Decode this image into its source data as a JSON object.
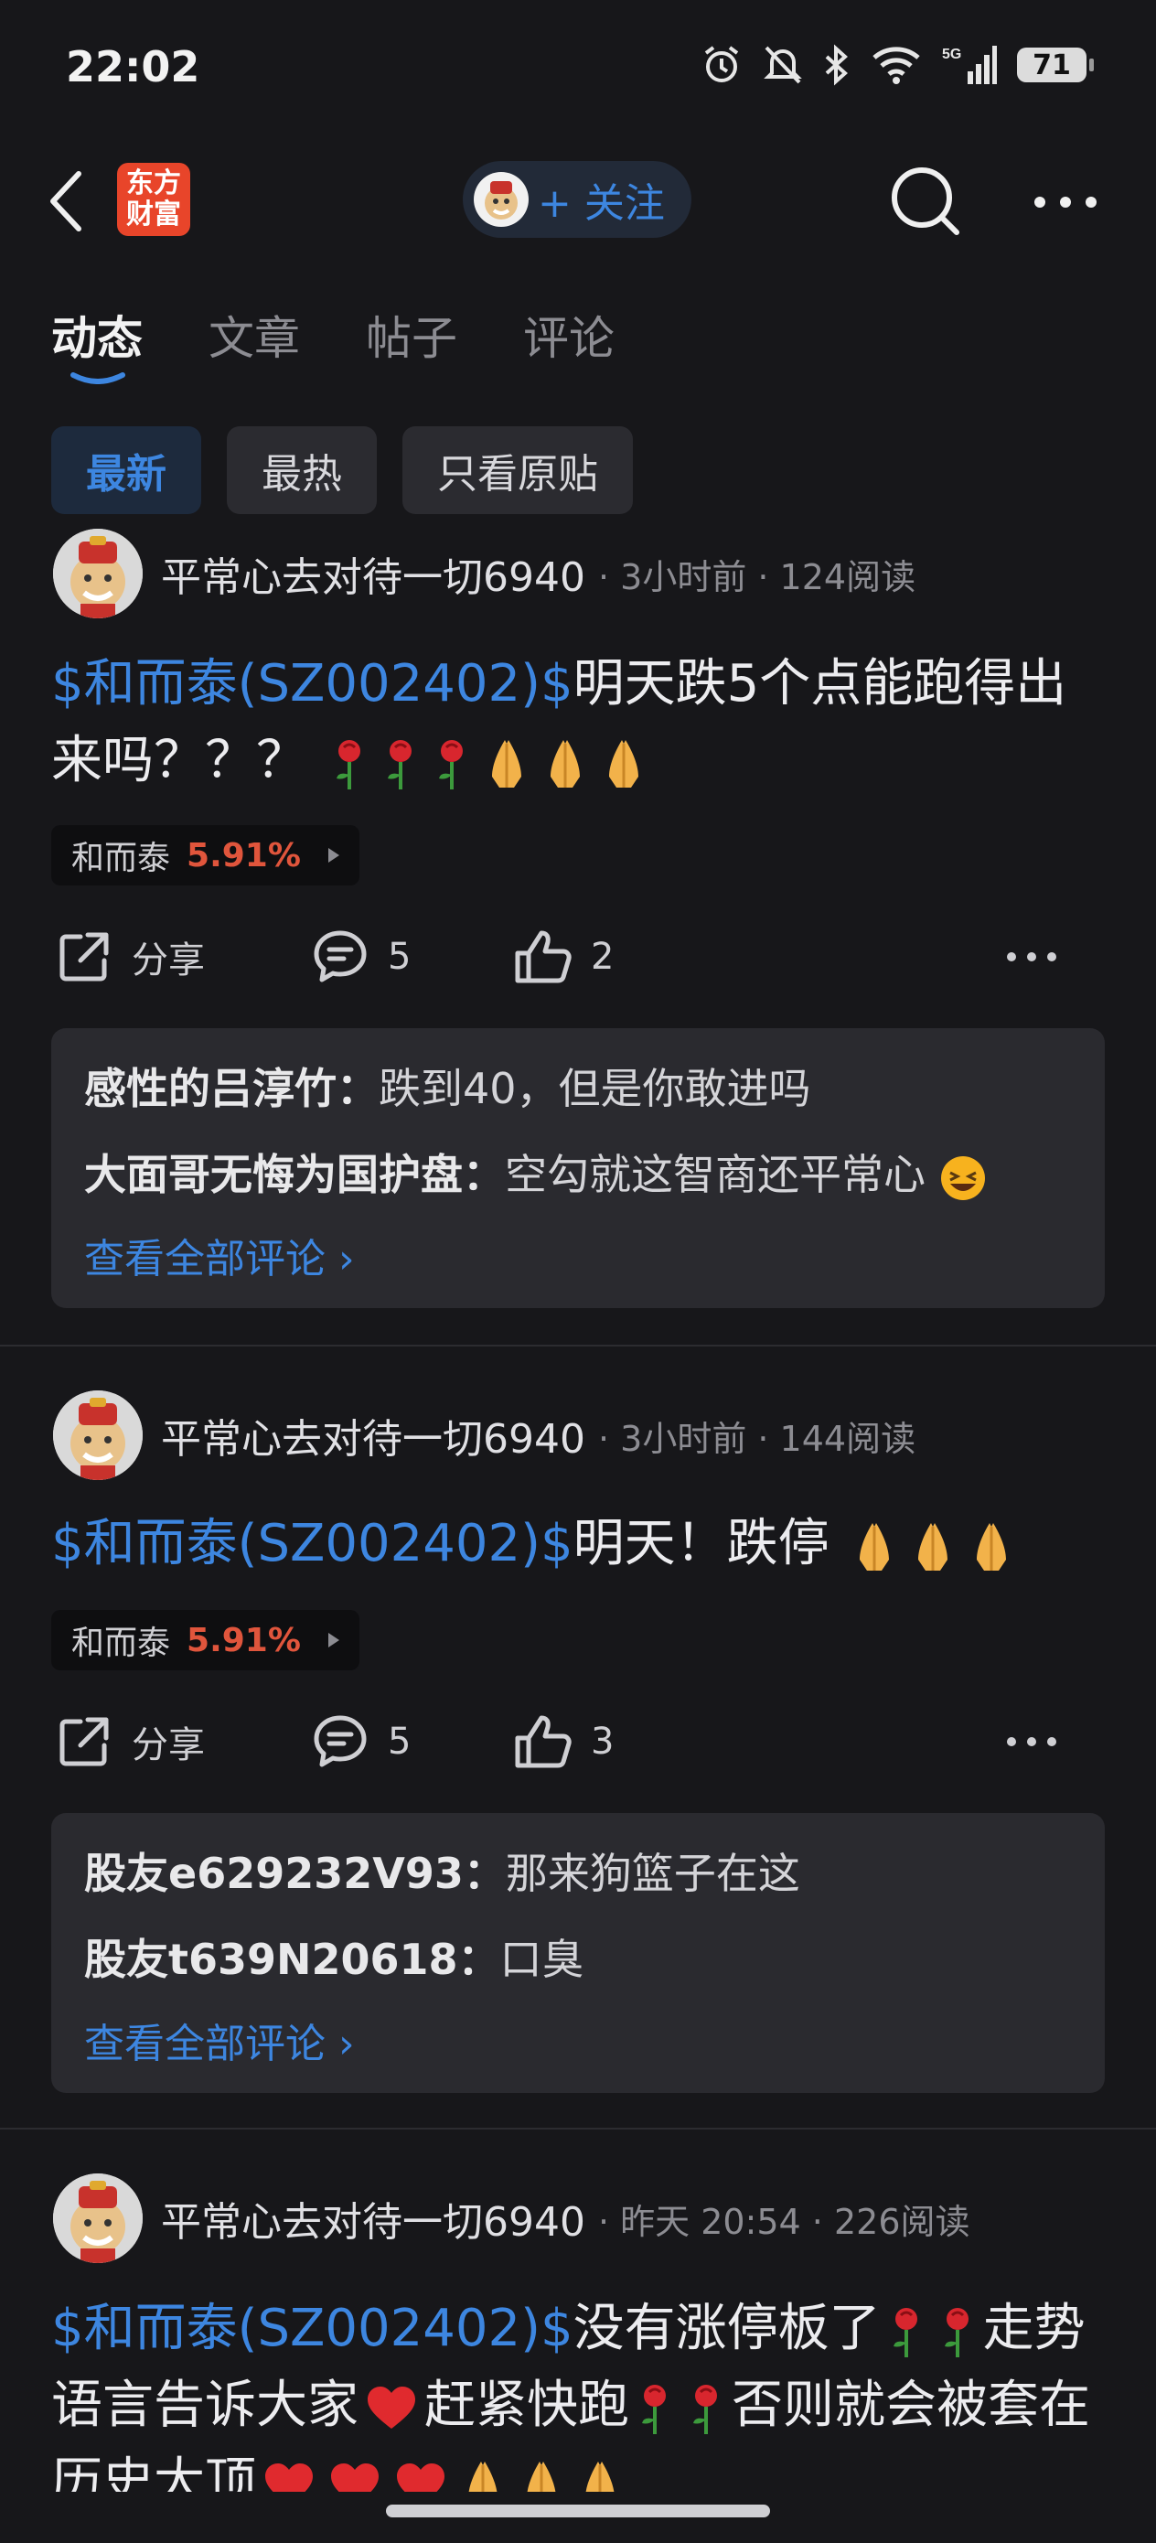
{
  "status": {
    "time": "22:02",
    "battery": "71",
    "network": "5G"
  },
  "header": {
    "logo_line1": "东方",
    "logo_line2": "财富",
    "follow_label": "+ 关注"
  },
  "tabs": [
    {
      "label": "动态",
      "active": true
    },
    {
      "label": "文章",
      "active": false
    },
    {
      "label": "帖子",
      "active": false
    },
    {
      "label": "评论",
      "active": false
    }
  ],
  "filters": [
    {
      "label": "最新",
      "active": true
    },
    {
      "label": "最热",
      "active": false
    },
    {
      "label": "只看原贴",
      "active": false
    }
  ],
  "posts": [
    {
      "user": "平常心去对待一切6940",
      "meta": "· 3小时前 · 124阅读",
      "tag": "$和而泰(SZ002402)$",
      "text": "明天跌5个点能跑得出来吗？？？",
      "quote_name": "和而泰",
      "quote_pct": "5.91%",
      "share_label": "分享",
      "comment_count": "5",
      "like_count": "2",
      "comments": [
        {
          "user": "感性的吕淳竹：",
          "text": "跌到40，但是你敢进吗"
        },
        {
          "user": "大面哥无悔为国护盘：",
          "text": "空勾就这智商还平常心"
        }
      ],
      "view_all": "查看全部评论"
    },
    {
      "user": "平常心去对待一切6940",
      "meta": "· 3小时前 · 144阅读",
      "tag": "$和而泰(SZ002402)$",
      "text": "明天！跌停",
      "quote_name": "和而泰",
      "quote_pct": "5.91%",
      "share_label": "分享",
      "comment_count": "5",
      "like_count": "3",
      "comments": [
        {
          "user": "股友e629232V93：",
          "text": "那来狗篮子在这"
        },
        {
          "user": "股友t639N20618：",
          "text": "口臭"
        }
      ],
      "view_all": "查看全部评论"
    },
    {
      "user": "平常心去对待一切6940",
      "meta": "· 昨天 20:54 · 226阅读",
      "tag": "$和而泰(SZ002402)$",
      "text_a": "没有涨停板了",
      "text_b": "走势语言告诉大家",
      "text_c": "赶紧快跑",
      "text_d": "否则就会被套在历史大顶"
    }
  ],
  "colors": {
    "accent": "#3d86e0",
    "up": "#e0553c",
    "background": "#17171a"
  }
}
